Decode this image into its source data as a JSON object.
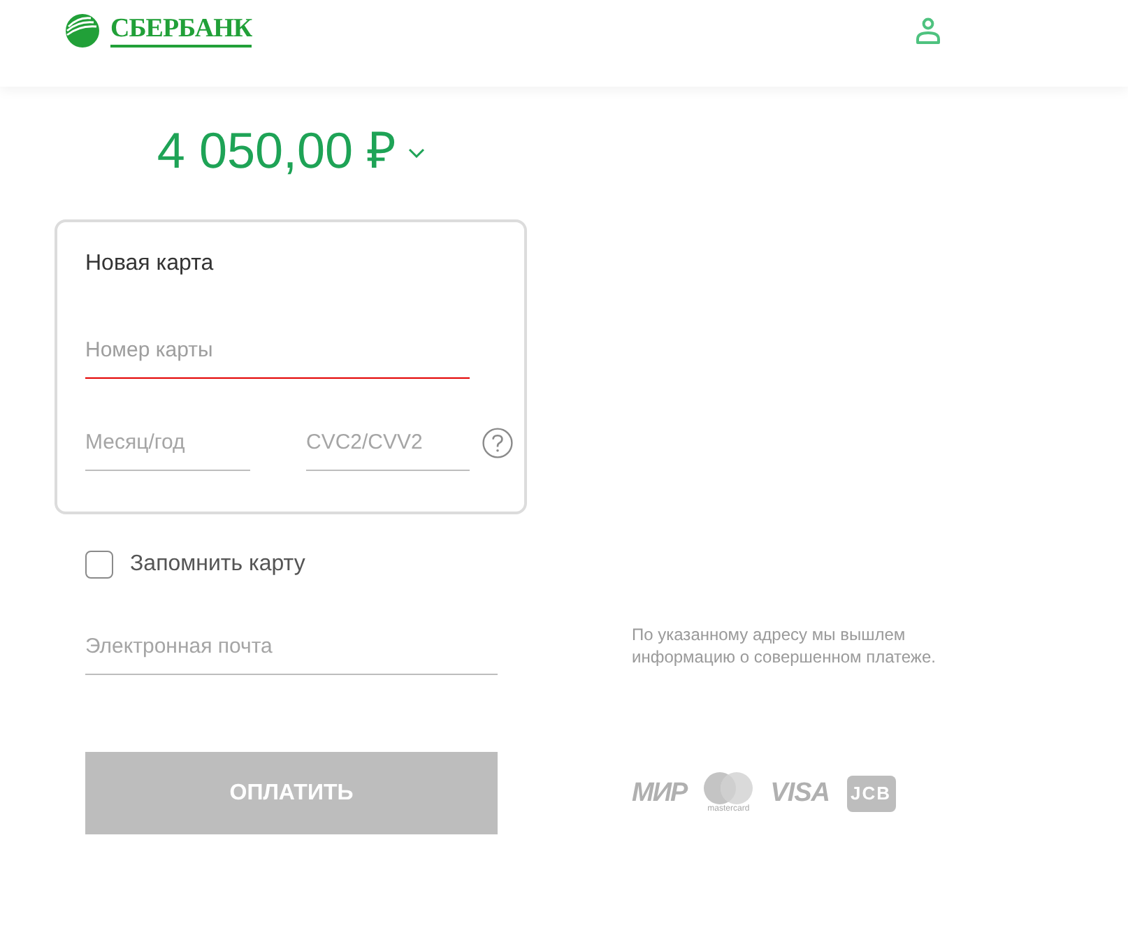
{
  "header": {
    "logo_text": "СБЕРБАНК"
  },
  "amount": {
    "value": "4 050,00 ₽"
  },
  "card_form": {
    "title": "Новая карта",
    "card_number": {
      "placeholder": "Номер карты",
      "invalid": true
    },
    "expiry": {
      "placeholder": "Месяц/год",
      "invalid": false
    },
    "cvc": {
      "placeholder": "CVC2/CVV2",
      "invalid": false
    }
  },
  "remember_card": {
    "label": "Запомнить карту",
    "checked": false
  },
  "email": {
    "placeholder": "Электронная почта",
    "invalid": false
  },
  "email_note": "По указанному адресу мы вышлем информацию о совершенном платеже.",
  "pay_button": {
    "label": "ОПЛАТИТЬ",
    "disabled": true
  },
  "payment_systems": [
    {
      "kind": "mir",
      "label": "МИР"
    },
    {
      "kind": "mastercard",
      "label": "mastercard"
    },
    {
      "kind": "visa",
      "label": "VISA"
    },
    {
      "kind": "jcb",
      "label": "JCB"
    }
  ]
}
